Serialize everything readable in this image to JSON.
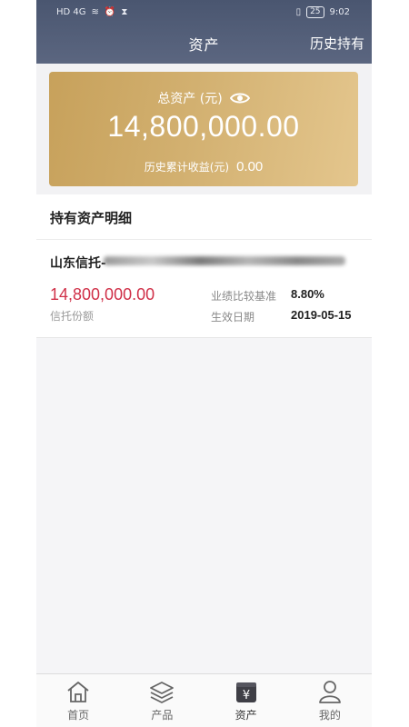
{
  "status": {
    "network": "HD 4G",
    "time": "9:02",
    "battery": "25"
  },
  "header": {
    "title": "资产",
    "right_action": "历史持有"
  },
  "summary": {
    "total_label": "总资产 (元)",
    "total_value": "14,800,000.00",
    "history_label": "历史累计收益(元)",
    "history_value": "0.00"
  },
  "holdings_section": {
    "title": "持有资产明细"
  },
  "holdings": [
    {
      "name": "山东信托-",
      "amount": "14,800,000.00",
      "amount_label": "信托份额",
      "benchmark_label": "业绩比较基准",
      "benchmark_value": "8.80%",
      "date_label": "生效日期",
      "date_value": "2019-05-15"
    }
  ],
  "tabs": [
    {
      "label": "首页",
      "icon": "home-icon"
    },
    {
      "label": "产品",
      "icon": "layers-icon"
    },
    {
      "label": "资产",
      "icon": "wallet-icon"
    },
    {
      "label": "我的",
      "icon": "user-icon"
    }
  ],
  "colors": {
    "header": "#4a5670",
    "card_gold": "#d2b070",
    "amount_red": "#d03048"
  }
}
